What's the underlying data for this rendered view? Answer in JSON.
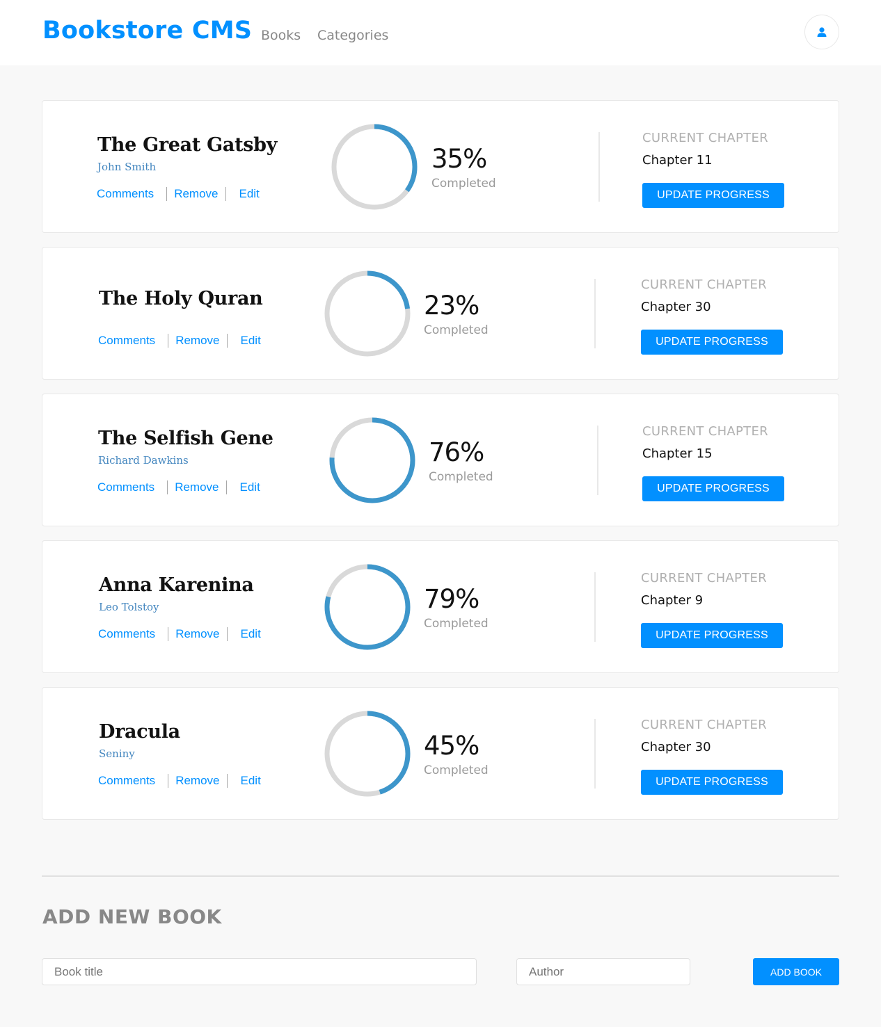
{
  "header": {
    "logo": "Bookstore CMS",
    "nav": [
      "Books",
      "Categories"
    ],
    "user_icon": "user-icon"
  },
  "colors": {
    "accent": "#0290ff",
    "progress": "#3d96cb",
    "track": "#d9d9d9",
    "author": "#4386bf"
  },
  "books": [
    {
      "title": "The Great Gatsby",
      "author": "John Smith",
      "progress": 35,
      "progress_text": "35%",
      "completed_label": "Completed",
      "chapter_label": "CURRENT CHAPTER",
      "chapter": "Chapter 11",
      "update_label": "UPDATE PROGRESS",
      "actions": [
        "Comments",
        "Remove",
        "Edit"
      ]
    },
    {
      "title": "The Holy Quran",
      "author": "",
      "progress": 23,
      "progress_text": "23%",
      "completed_label": "Completed",
      "chapter_label": "CURRENT CHAPTER",
      "chapter": "Chapter 30",
      "update_label": "UPDATE PROGRESS",
      "actions": [
        "Comments",
        "Remove",
        "Edit"
      ]
    },
    {
      "title": "The Selfish Gene",
      "author": "Richard Dawkins",
      "progress": 76,
      "progress_text": "76%",
      "completed_label": "Completed",
      "chapter_label": "CURRENT CHAPTER",
      "chapter": "Chapter 15",
      "update_label": "UPDATE PROGRESS",
      "actions": [
        "Comments",
        "Remove",
        "Edit"
      ]
    },
    {
      "title": "Anna Karenina",
      "author": "Leo Tolstoy",
      "progress": 79,
      "progress_text": "79%",
      "completed_label": "Completed",
      "chapter_label": "CURRENT CHAPTER",
      "chapter": "Chapter 9",
      "update_label": "UPDATE PROGRESS",
      "actions": [
        "Comments",
        "Remove",
        "Edit"
      ]
    },
    {
      "title": "Dracula",
      "author": "Seniny",
      "progress": 45,
      "progress_text": "45%",
      "completed_label": "Completed",
      "chapter_label": "CURRENT CHAPTER",
      "chapter": "Chapter 30",
      "update_label": "UPDATE PROGRESS",
      "actions": [
        "Comments",
        "Remove",
        "Edit"
      ]
    }
  ],
  "add_form": {
    "heading": "ADD NEW BOOK",
    "title_placeholder": "Book title",
    "author_placeholder": "Author",
    "submit_label": "ADD BOOK"
  }
}
